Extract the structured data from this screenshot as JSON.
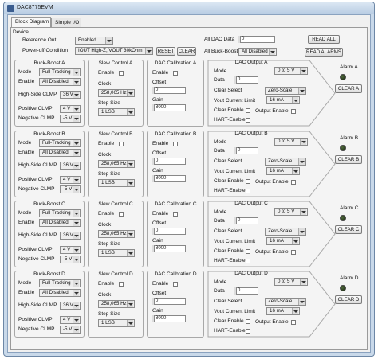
{
  "window": {
    "title": "DAC8775EVM"
  },
  "tabs": [
    "Block Diagram",
    "Simple I/O"
  ],
  "device": {
    "section_label": "Device",
    "reference_out_label": "Reference Out",
    "reference_out_value": "Enabled",
    "power_off_label": "Power-off Condition",
    "power_off_value": "IOUT High-Z, VOUT 30kOhm",
    "reset_label": "RESET",
    "clear_label": "CLEAR",
    "all_dac_data_label": "All DAC Data",
    "all_dac_data_value": "0",
    "all_buck_boost_label": "All Buck-Boost",
    "all_buck_boost_value": "All Disabled",
    "read_all_label": "READ ALL",
    "read_alarms_label": "READ ALARMS"
  },
  "labels": {
    "mode": "Mode",
    "enable": "Enable",
    "high_side": "High-Side CLMP",
    "positive": "Positive CLMP",
    "negative": "Negative CLMP",
    "clock": "Clock",
    "step_size": "Step Size",
    "offset": "Offset",
    "gain": "Gain",
    "data": "Data",
    "clear_select": "Clear Select",
    "vout_limit": "Vout Current Limit",
    "clear_enable": "Clear Enable",
    "output_enable": "Output Enable",
    "hart_enable": "HART-Enable",
    "clear_button": "CLEAR"
  },
  "channels": [
    {
      "bb_title": "Buck-Boost A",
      "sc_title": "Slew Control A",
      "cal_title": "DAC Calibration A",
      "out_title": "DAC Output A",
      "alarm_label": "Alarm A",
      "clear_label": "CLEAR A",
      "mode": "Full-Tracking",
      "enable": "All Disabled",
      "high_side": "36 V",
      "positive": "4 V",
      "negative": "-5 V",
      "clock": "258,065 Hz",
      "step": "1 LSB",
      "offset": "0",
      "gain": "8000",
      "range": "0 to 5 V",
      "data": "0",
      "clear_select": "Zero-Scale",
      "vout_limit": "16 mA"
    },
    {
      "bb_title": "Buck-Boost B",
      "sc_title": "Slew Control B",
      "cal_title": "DAC Calibration B",
      "out_title": "DAC Output B",
      "alarm_label": "Alarm B",
      "clear_label": "CLEAR B",
      "mode": "Full-Tracking",
      "enable": "All Disabled",
      "high_side": "36 V",
      "positive": "4 V",
      "negative": "-5 V",
      "clock": "258,065 Hz",
      "step": "1 LSB",
      "offset": "0",
      "gain": "8000",
      "range": "0 to 5 V",
      "data": "0",
      "clear_select": "Zero-Scale",
      "vout_limit": "16 mA"
    },
    {
      "bb_title": "Buck-Boost C",
      "sc_title": "Slew Control C",
      "cal_title": "DAC Calibration C",
      "out_title": "DAC Output C",
      "alarm_label": "Alarm C",
      "clear_label": "CLEAR C",
      "mode": "Full-Tracking",
      "enable": "All Disabled",
      "high_side": "36 V",
      "positive": "4 V",
      "negative": "-5 V",
      "clock": "258,065 Hz",
      "step": "1 LSB",
      "offset": "0",
      "gain": "8000",
      "range": "0 to 5 V",
      "data": "0",
      "clear_select": "Zero-Scale",
      "vout_limit": "16 mA"
    },
    {
      "bb_title": "Buck-Boost D",
      "sc_title": "Slew Control D",
      "cal_title": "DAC Calibration D",
      "out_title": "DAC Output D",
      "alarm_label": "Alarm D",
      "clear_label": "CLEAR D",
      "mode": "Full-Tracking",
      "enable": "All Disabled",
      "high_side": "36 V",
      "positive": "4 V",
      "negative": "-5 V",
      "clock": "258,065 Hz",
      "step": "1 LSB",
      "offset": "0",
      "gain": "8000",
      "range": "0 to 5 V",
      "data": "0",
      "clear_select": "Zero-Scale",
      "vout_limit": "16 mA"
    }
  ]
}
